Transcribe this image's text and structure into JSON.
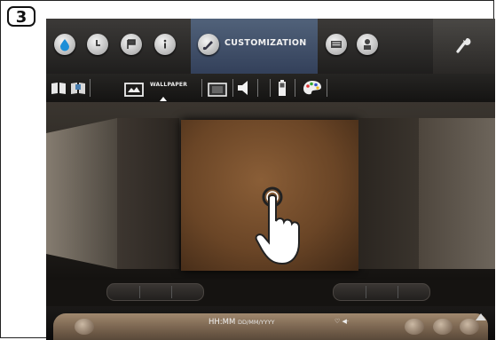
{
  "step_number": "3",
  "nav": {
    "active_label": "CUSTOMIZATION",
    "icons": [
      "water-drop-icon",
      "clock-icon",
      "flag-icon",
      "info-icon",
      "brush-icon",
      "keyboard-icon",
      "chef-icon",
      "wrench-icon"
    ]
  },
  "subbar": {
    "wallpaper_label": "WALLPAPER",
    "icons": [
      "book-icon",
      "book-open-icon",
      "wallpaper-icon",
      "screen-icon",
      "speaker-icon",
      "battery-icon",
      "palette-icon"
    ]
  },
  "status": {
    "time": "HH:MM",
    "date": "DD/MM/YYYY",
    "right": "♡ ◀·"
  },
  "colors": {
    "active_tab": "#44536c",
    "background": "#2a2724"
  }
}
